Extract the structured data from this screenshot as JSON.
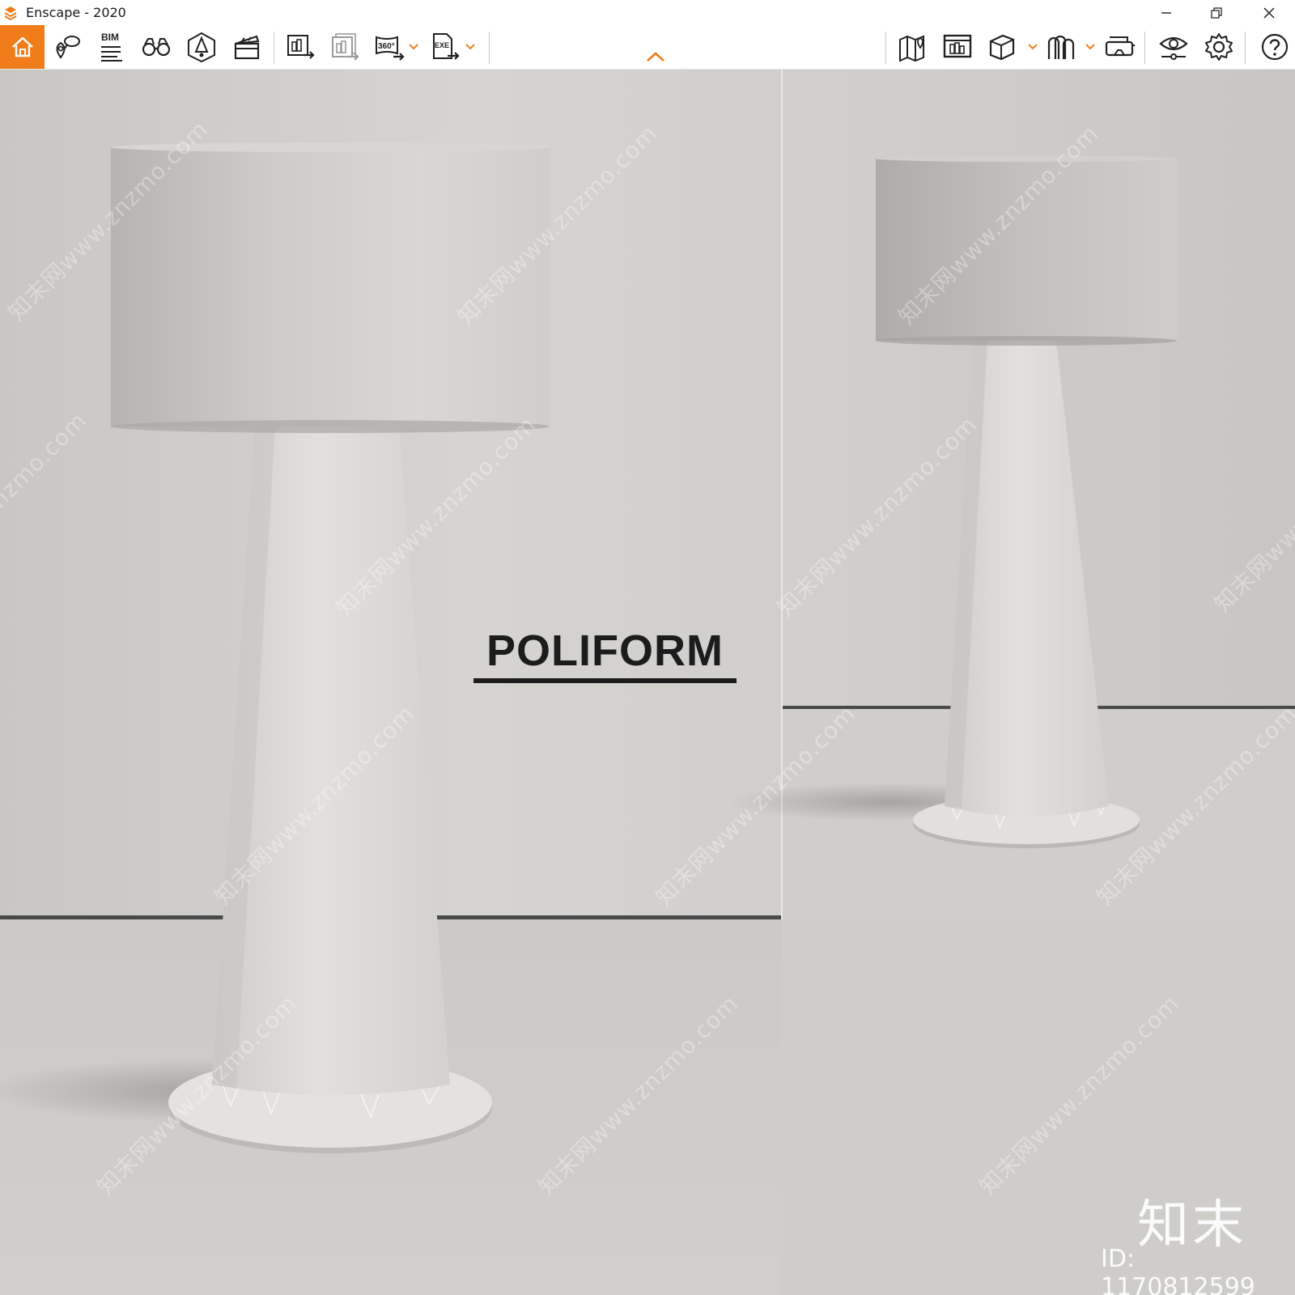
{
  "window": {
    "title": "Enscape - 2020",
    "controls": [
      "minimize",
      "restore",
      "close"
    ]
  },
  "toolbar": {
    "accent_color": "#f07d1a",
    "left_icons": [
      "home-icon",
      "location-pin-icon",
      "bim-icon",
      "binoculars-icon",
      "light-view-icon",
      "clapperboard-icon",
      "screenshot-export-icon",
      "batch-render-icon",
      "panorama-360-icon",
      "exe-export-icon"
    ],
    "bim_label": "BIM",
    "panorama_label": "360°",
    "exe_label": "EXE",
    "right_icons": [
      "map-icon",
      "asset-library-icon",
      "cube-view-icon",
      "archway-icon",
      "vr-headset-icon",
      "visual-settings-icon",
      "settings-gear-icon",
      "help-icon"
    ]
  },
  "viewport": {
    "brand_text": "POLIFORM",
    "watermark_text": "知末网www.znzmo.com",
    "corner_logo": "知末",
    "corner_id": "ID: 1170812599"
  }
}
